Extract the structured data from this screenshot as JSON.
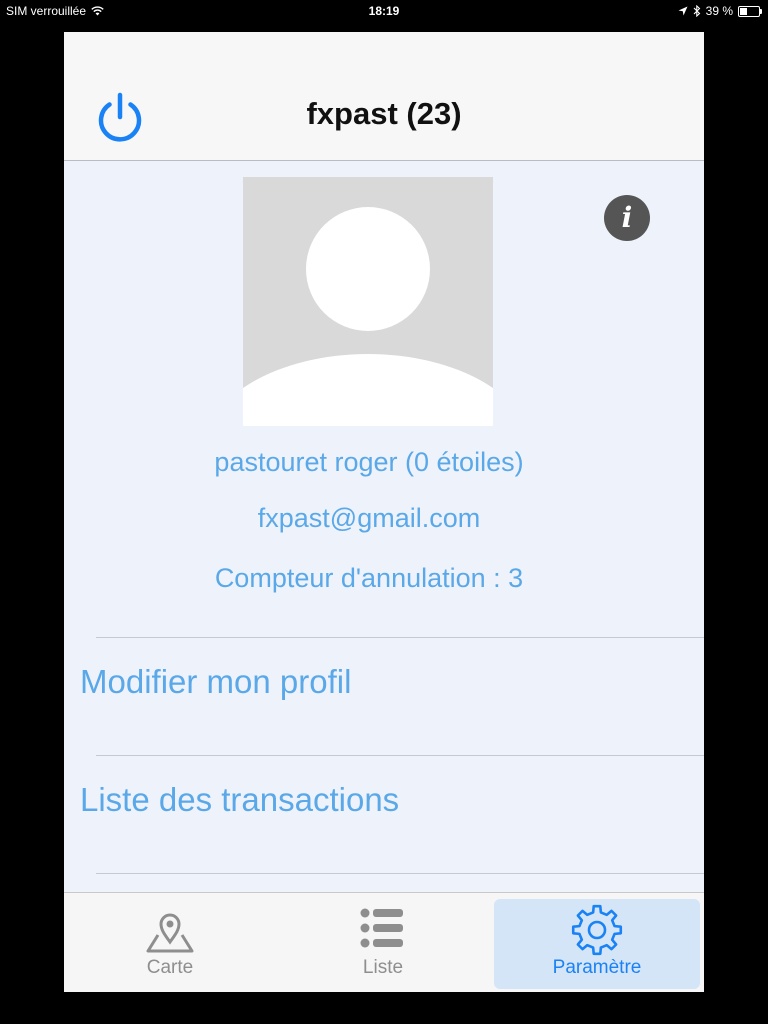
{
  "status_bar": {
    "carrier": "SIM verrouillée",
    "time": "18:19",
    "battery": "39 %",
    "battery_level": 0.39,
    "icons": [
      "wifi-icon",
      "location-arrow-icon",
      "bluetooth-icon",
      "battery-icon"
    ]
  },
  "header": {
    "title": "fxpast (23)",
    "power_icon": "power-icon",
    "info_icon": "info-icon"
  },
  "profile": {
    "avatar_icon": "user-silhouette",
    "name_line": "pastouret roger (0 étoiles)",
    "email": "fxpast@gmail.com",
    "cancel_counter": "Compteur d'annulation : 3"
  },
  "menu": {
    "items": [
      {
        "label": "Modifier mon profil"
      },
      {
        "label": "Liste des transactions"
      }
    ]
  },
  "tabbar": {
    "tabs": [
      {
        "label": "Carte",
        "icon": "map-pin-icon",
        "active": false
      },
      {
        "label": "Liste",
        "icon": "list-icon",
        "active": false
      },
      {
        "label": "Paramètre",
        "icon": "gear-icon",
        "active": true
      }
    ]
  },
  "colors": {
    "accent": "#1a82f5",
    "link_text": "#5aa8e8",
    "content_bg": "#eef3fb",
    "active_tab_bg": "#d4e5f8"
  }
}
